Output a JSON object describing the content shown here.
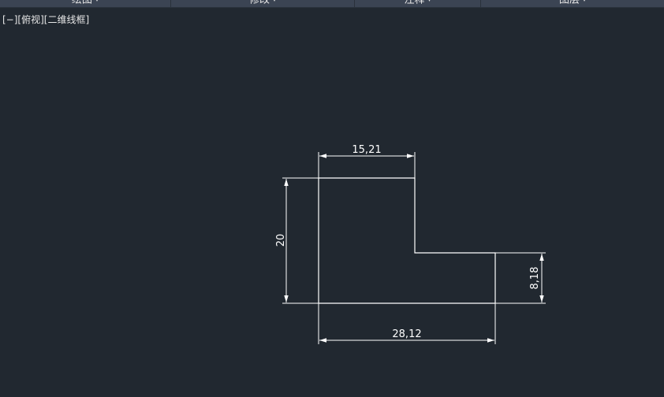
{
  "ribbon": {
    "panels": [
      {
        "label": "绘图",
        "arrow": "▾"
      },
      {
        "label": "修改",
        "arrow": "▾"
      },
      {
        "label": "注释",
        "arrow": "▾"
      },
      {
        "label": "图层",
        "arrow": "▾"
      }
    ]
  },
  "viewport": {
    "controls": {
      "viewport_menu": "[−]",
      "view_preset": "[俯视]",
      "visual_style": "[二维线框]"
    },
    "dimensions": {
      "top_width": "15,21",
      "left_height": "20",
      "right_height": "8,18",
      "bottom_width": "28,12"
    }
  },
  "colors": {
    "background": "#212830",
    "ribbon": "#3b4453",
    "geometry": "#ffffff"
  }
}
